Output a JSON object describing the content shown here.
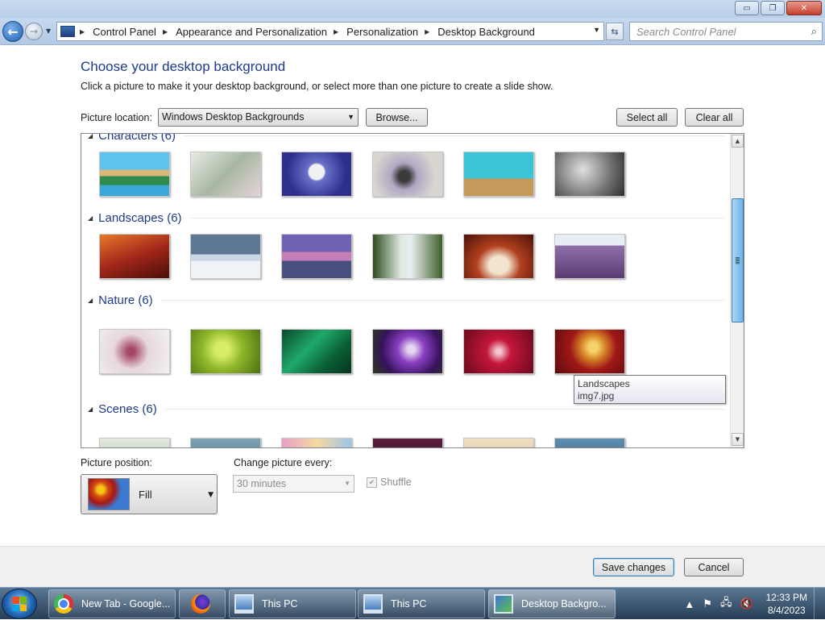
{
  "window": {
    "minimize": "▭",
    "maximize": "❐",
    "close": "✕"
  },
  "address": {
    "breadcrumbs": [
      "Control Panel",
      "Appearance and Personalization",
      "Personalization",
      "Desktop Background"
    ],
    "search_placeholder": "Search Control Panel"
  },
  "page": {
    "title": "Choose your desktop background",
    "subtitle": "Click a picture to make it your desktop background, or select more than one picture to create a slide show.",
    "picture_location_label": "Picture location:",
    "picture_location_value": "Windows Desktop Backgrounds",
    "browse_label": "Browse...",
    "select_all_label": "Select all",
    "clear_all_label": "Clear all"
  },
  "groups": [
    {
      "name": "Characters (6)"
    },
    {
      "name": "Landscapes (6)"
    },
    {
      "name": "Nature (6)"
    },
    {
      "name": "Scenes (6)"
    }
  ],
  "tooltip": {
    "line1": "Landscapes",
    "line2": "img7.jpg"
  },
  "position": {
    "label": "Picture position:",
    "value": "Fill"
  },
  "interval": {
    "label": "Change picture every:",
    "value": "30 minutes"
  },
  "shuffle": {
    "label": "Shuffle",
    "checked": true
  },
  "footer": {
    "save_label": "Save changes",
    "cancel_label": "Cancel"
  },
  "taskbar": {
    "items": [
      {
        "label": "New Tab - Google...",
        "icon": "chrome-icon"
      },
      {
        "label": "",
        "icon": "firefox-icon"
      },
      {
        "label": "This PC",
        "icon": "computer-icon"
      },
      {
        "label": "This PC",
        "icon": "computer-icon"
      },
      {
        "label": "Desktop Backgro...",
        "icon": "desktop-background-icon"
      }
    ],
    "time": "12:33 PM",
    "date": "8/4/2023"
  }
}
